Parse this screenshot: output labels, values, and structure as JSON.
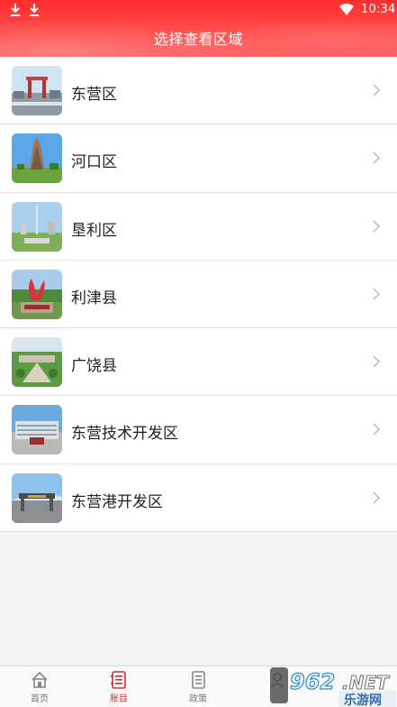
{
  "status_bar": {
    "time": "10:34"
  },
  "header": {
    "title": "选择查看区域"
  },
  "regions": [
    {
      "label": "东营区"
    },
    {
      "label": "河口区"
    },
    {
      "label": "垦利区"
    },
    {
      "label": "利津县"
    },
    {
      "label": "广饶县"
    },
    {
      "label": "东营技术开发区"
    },
    {
      "label": "东营港开发区"
    }
  ],
  "tabbar": {
    "tabs": [
      {
        "label": "首页",
        "icon": "home-icon",
        "active": false
      },
      {
        "label": "账目",
        "icon": "ledger-icon",
        "active": true
      },
      {
        "label": "政策",
        "icon": "document-icon",
        "active": false
      },
      {
        "label": "",
        "icon": "profile-icon",
        "active": false
      }
    ]
  },
  "watermark": {
    "text_left": "962",
    "text_right": ".NET",
    "subtitle": "乐游网"
  },
  "colors": {
    "header_red": "#ff3b3b",
    "accent_red": "#e3262b",
    "background": "#f2f2f2"
  }
}
